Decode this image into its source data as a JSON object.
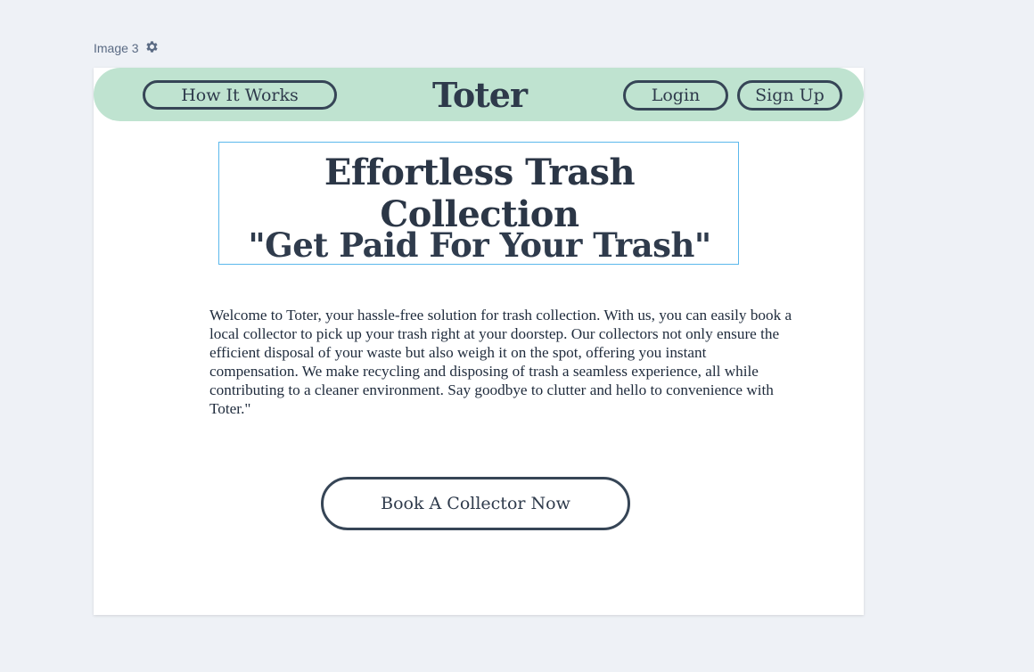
{
  "canvas": {
    "label": "Image 3",
    "settings_icon": "gear-icon"
  },
  "navbar": {
    "how_it_works": "How It Works",
    "logo": "Toter",
    "login": "Login",
    "sign_up": "Sign Up"
  },
  "hero": {
    "title": "Effortless Trash Collection",
    "subtitle": "\"Get Paid For Your Trash\"",
    "body": "Welcome to Toter, your hassle-free solution for trash collection. With us, you can easily book a local collector to pick up your trash right at your doorstep. Our collectors not only ensure the efficient disposal of your waste but also weigh it on the spot, offering you instant compensation. We make recycling and disposing of trash a seamless experience, all while contributing to a cleaner environment. Say goodbye to clutter and hello to convenience with Toter.\"",
    "cta": "Book A Collector Now"
  },
  "colors": {
    "nav_background": "#bfe3d0",
    "ink": "#2e3a4b",
    "selection_outline": "#5bb8ec",
    "workspace_background": "#eef1f6"
  }
}
